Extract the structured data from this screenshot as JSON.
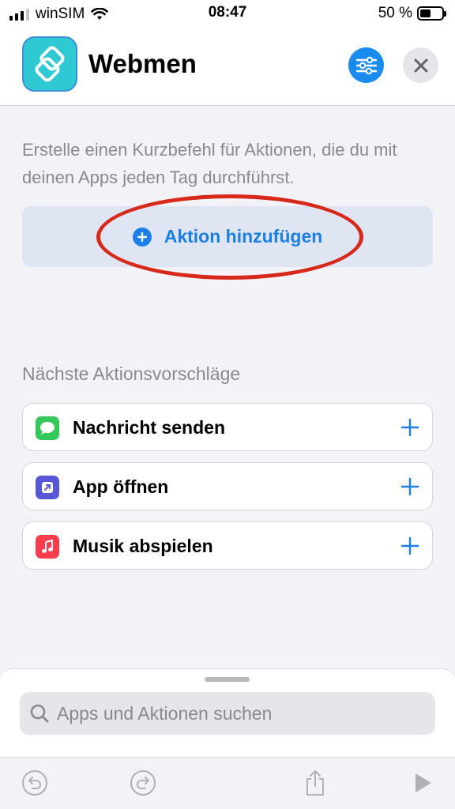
{
  "status_bar": {
    "carrier": "winSIM",
    "time": "08:47",
    "battery_percent": "50 %",
    "battery_level": 0.5,
    "signal_bars": 3
  },
  "header": {
    "title": "Webmen",
    "app_icon": "shortcuts-icon",
    "settings_icon": "sliders-icon",
    "close_icon": "close-icon"
  },
  "editor": {
    "description": "Erstelle einen Kurzbefehl für Aktionen, die du mit deinen Apps jeden Tag durchführst.",
    "add_action_label": "Aktion hinzufügen"
  },
  "suggestions": {
    "title": "Nächste Aktionsvorschläge",
    "items": [
      {
        "label": "Nachricht senden",
        "icon": "messages-icon",
        "color": "#34c759"
      },
      {
        "label": "App öffnen",
        "icon": "open-app-icon",
        "color": "#5856d6"
      },
      {
        "label": "Musik abspielen",
        "icon": "music-icon",
        "color": "#fa3c4c"
      }
    ]
  },
  "search": {
    "placeholder": "Apps und Aktionen suchen"
  },
  "toolbar": {
    "undo_icon": "undo-icon",
    "redo_icon": "redo-icon",
    "share_icon": "share-icon",
    "play_icon": "play-icon"
  },
  "colors": {
    "accent": "#1a7fe6",
    "highlight": "#d8281a",
    "app_icon": "#2fc9d4"
  }
}
